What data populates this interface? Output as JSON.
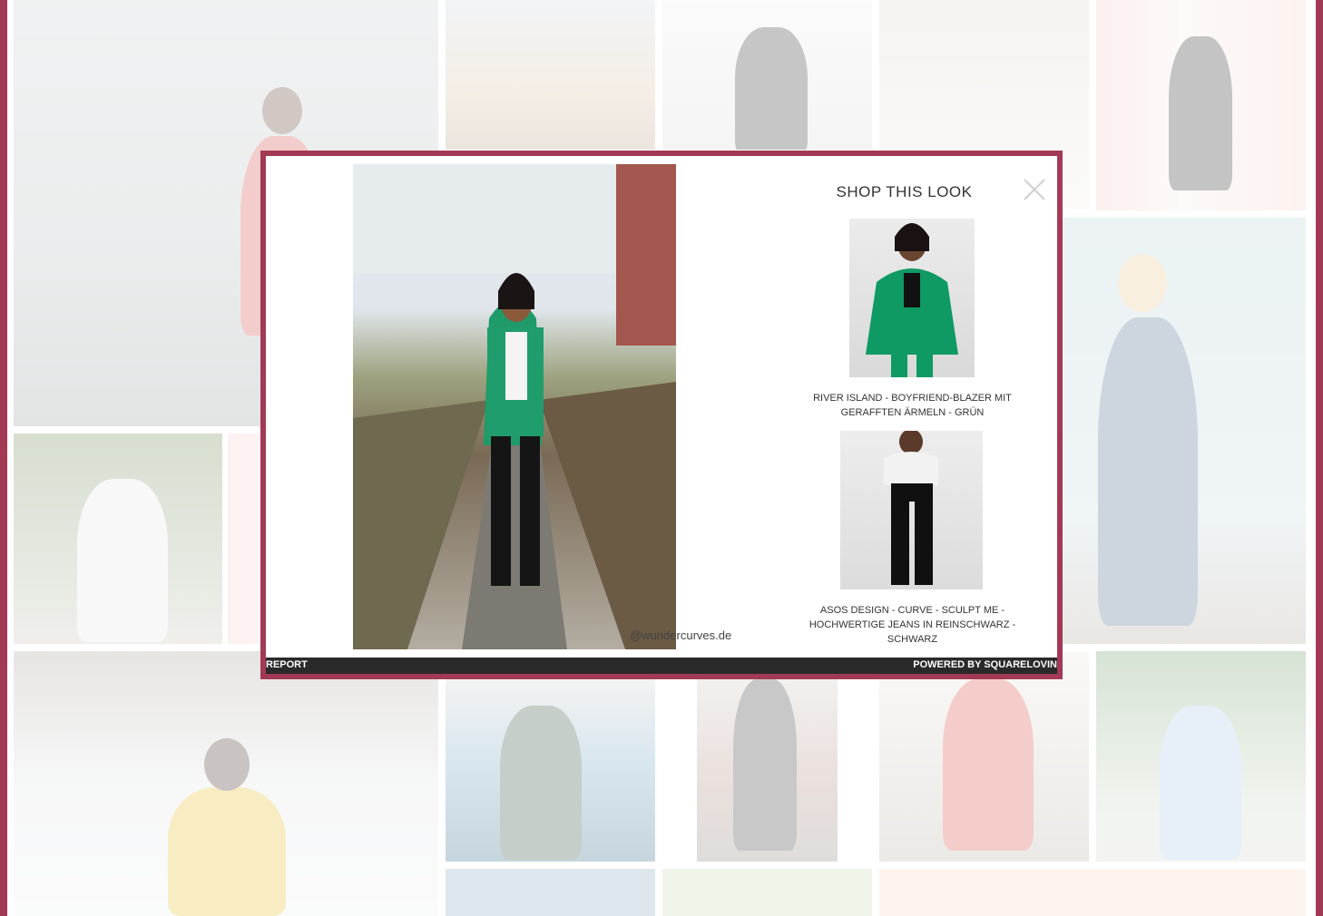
{
  "modal": {
    "title": "SHOP THIS LOOK",
    "photo_credit": "@wundercurves.de",
    "report_label": "REPORT",
    "powered_label": "POWERED BY SQUARELOVIN",
    "close_icon": "close-icon"
  },
  "products": [
    {
      "name": "RIVER ISLAND - BOYFRIEND-BLAZER MIT GERAFFTEN ÄRMELN - GRÜN"
    },
    {
      "name": "ASOS DESIGN - CURVE - SCULPT ME - HOCHWERTIGE JEANS IN REINSCHWARZ - SCHWARZ"
    }
  ],
  "colors": {
    "accent": "#a23a55",
    "footer": "#2a2a2a"
  }
}
